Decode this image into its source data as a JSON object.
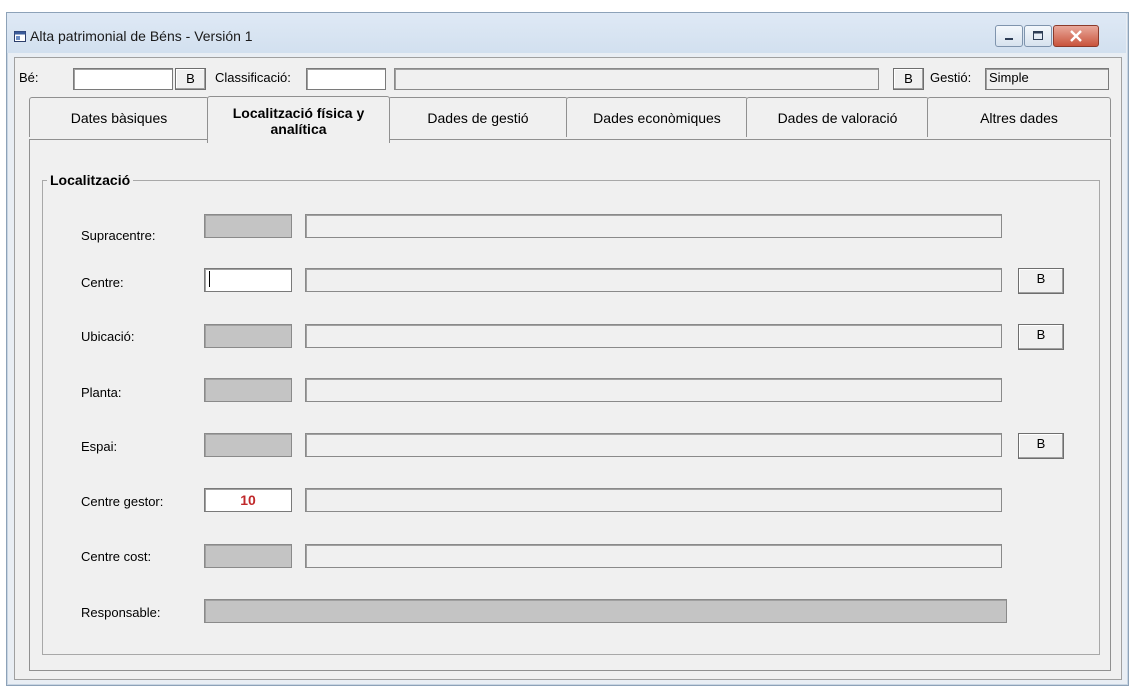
{
  "window": {
    "title": "Alta patrimonial de Béns - Versión 1",
    "icon": "app-window-icon"
  },
  "header": {
    "be_label": "Bé:",
    "be_value": "",
    "be_button": "B",
    "classificacio_label": "Classificació:",
    "classificacio_value": "",
    "classificacio_desc": "",
    "classificacio_button": "B",
    "gestio_label": "Gestió:",
    "gestio_value": "Simple"
  },
  "tabs": [
    {
      "label": "Dates bàsiques",
      "active": false
    },
    {
      "label": "Localització física y analítica",
      "active": true
    },
    {
      "label": "Dades de gestió",
      "active": false
    },
    {
      "label": "Dades econòmiques",
      "active": false
    },
    {
      "label": "Dades de valoració",
      "active": false
    },
    {
      "label": "Altres dades",
      "active": false
    }
  ],
  "group": {
    "title": "Localització",
    "fields": [
      {
        "label": "Supracentre:",
        "code": "",
        "desc": "",
        "has_button": false
      },
      {
        "label": "Centre:",
        "code": "",
        "desc": "",
        "has_button": true,
        "button": "B"
      },
      {
        "label": "Ubicació:",
        "code": "",
        "desc": "",
        "has_button": true,
        "button": "B"
      },
      {
        "label": "Planta:",
        "code": "",
        "desc": "",
        "has_button": false
      },
      {
        "label": "Espai:",
        "code": "",
        "desc": "",
        "has_button": true,
        "button": "B"
      },
      {
        "label": "Centre gestor:",
        "code": "10",
        "desc": "",
        "has_button": false
      },
      {
        "label": "Centre cost:",
        "code": "",
        "desc": "",
        "has_button": false
      },
      {
        "label": "Responsable:",
        "code": "",
        "desc": "",
        "has_button": false
      }
    ]
  },
  "colors": {
    "title_bg": "#d2e0ef",
    "form_bg": "#f0f0f0",
    "disabled_field": "#c4c4c4",
    "accent_value": "#c0282a",
    "close_button": "#c9543c"
  }
}
